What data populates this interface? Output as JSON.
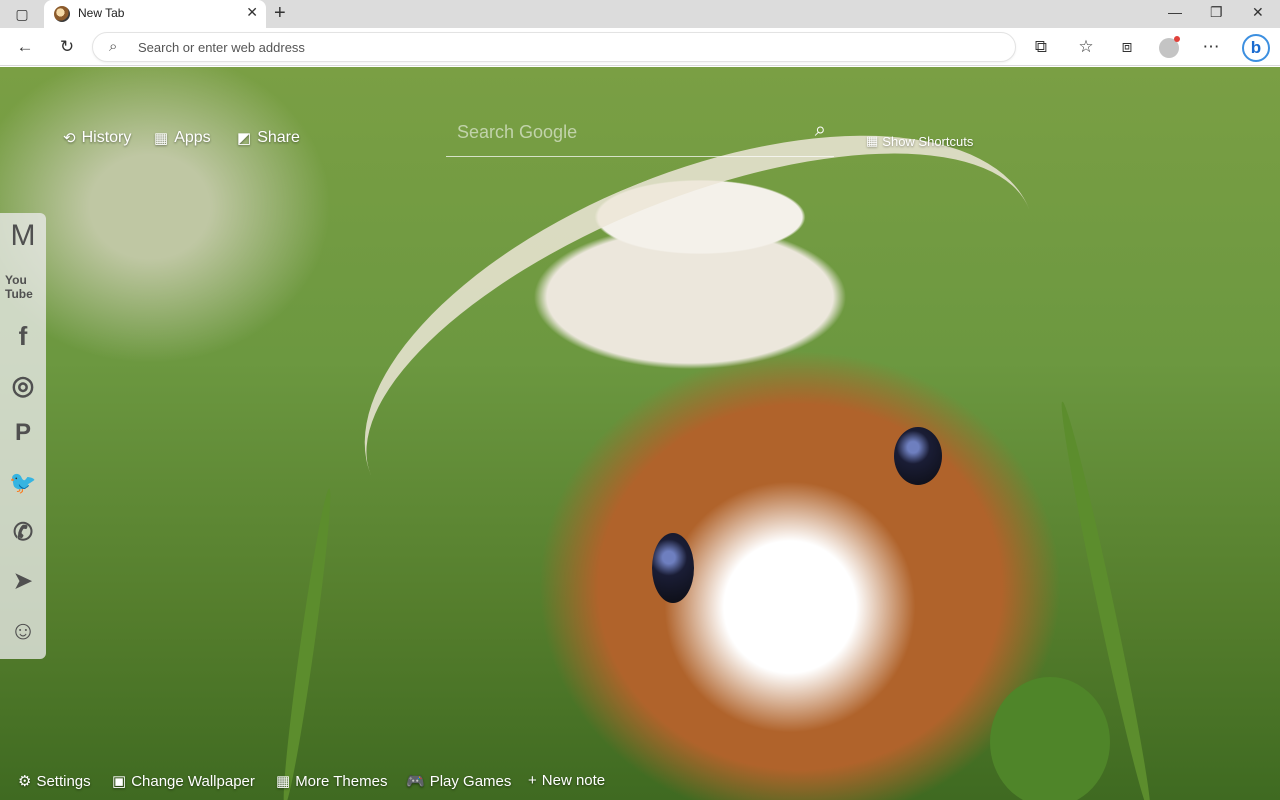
{
  "browser": {
    "tab_title": "New Tab",
    "new_tab_symbol": "+",
    "address_placeholder": "Search or enter web address",
    "icons": [
      "sidebar-toggle-icon",
      "back-icon",
      "reload-icon",
      "search-icon",
      "extensions-icon",
      "favorites-icon",
      "collections-icon",
      "profile-icon",
      "more-icon",
      "bing-icon",
      "minimize-icon",
      "restore-icon",
      "close-icon"
    ]
  },
  "top_links": {
    "history": "History",
    "apps": "Apps",
    "share": "Share"
  },
  "search": {
    "placeholder": "Search Google"
  },
  "shortcuts_label": "Show Shortcuts",
  "social": {
    "gmail": "M",
    "youtube": "You Tube",
    "facebook": "f",
    "instagram": "◎",
    "pinterest": "P",
    "twitter": "🐦",
    "whatsapp": "✆",
    "telegram": "➤",
    "reddit": "☺"
  },
  "bottom": {
    "settings": "Settings",
    "change_wallpaper": "Change Wallpaper",
    "more_themes": "More Themes",
    "play_games": "Play Games",
    "new_note": "New note"
  }
}
